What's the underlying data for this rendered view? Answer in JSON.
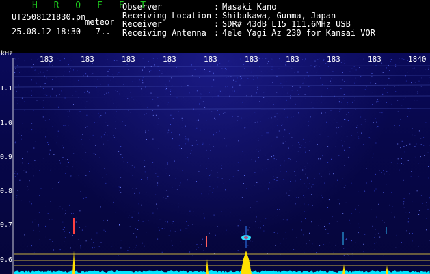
{
  "header": {
    "brand": "H R O F F T",
    "filename": "UT2508121830.pn",
    "tag": "meteor",
    "datetime": "25.08.12 18:30",
    "count": "7..",
    "info_rows": [
      {
        "label": "Observer",
        "value": "Masaki Kano"
      },
      {
        "label": "Receiving Location",
        "value": "Shibukawa, Gunma, Japan"
      },
      {
        "label": "Receiver",
        "value": "SDR# 43dB L15 111.6MHz USB"
      },
      {
        "label": "Receiving Antenna",
        "value": "4ele Yagi Az 230 for Kansai VOR"
      }
    ],
    "separator": ":"
  },
  "axes": {
    "unit": "kHz",
    "y_ticks": [
      "1.1",
      "1.0",
      "0.9",
      "0.8",
      "0.7",
      "0.6"
    ],
    "x_ticks": [
      "183",
      "183",
      "183",
      "183",
      "183",
      "183",
      "183",
      "183",
      "183",
      "1840"
    ]
  },
  "colors": {
    "brand": "#1ec81e",
    "background": "#000000",
    "spectrum_fill": "#00e5ff",
    "signal": "#ffe000",
    "guide_line": "#c8b040"
  }
}
